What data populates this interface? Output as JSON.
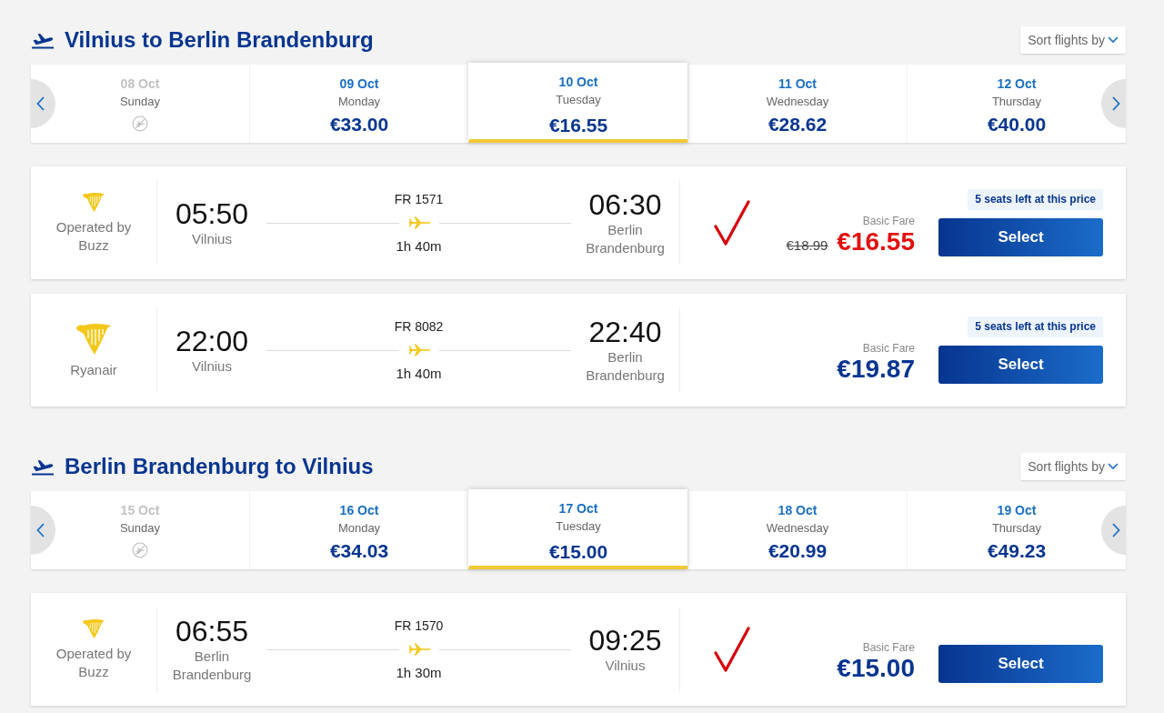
{
  "sections": [
    {
      "title": "Vilnius to Berlin Brandenburg",
      "sort_label": "Sort flights by",
      "dates": [
        {
          "date": "08 Oct",
          "day": "Sunday",
          "available": false,
          "selected": false
        },
        {
          "date": "09 Oct",
          "day": "Monday",
          "available": true,
          "price": "€33.00",
          "selected": false
        },
        {
          "date": "10 Oct",
          "day": "Tuesday",
          "available": true,
          "price": "€16.55",
          "selected": true
        },
        {
          "date": "11 Oct",
          "day": "Wednesday",
          "available": true,
          "price": "€28.62",
          "selected": false
        },
        {
          "date": "12 Oct",
          "day": "Thursday",
          "available": true,
          "price": "€40.00",
          "selected": false
        }
      ],
      "flights": [
        {
          "operator": {
            "kind": "partner",
            "label": "Operated by Buzz"
          },
          "departure": {
            "time": "05:50",
            "city": "Vilnius"
          },
          "flight_number": "FR 1571",
          "duration": "1h 40m",
          "arrival": {
            "time": "06:30",
            "city": "Berlin Brandenburg"
          },
          "checked": true,
          "fare_label": "Basic Fare",
          "old_price": "€18.99",
          "price": "€16.55",
          "sale": true,
          "seats_badge": "5 seats left at this price",
          "button": "Select"
        },
        {
          "operator": {
            "kind": "own",
            "label": "Ryanair"
          },
          "departure": {
            "time": "22:00",
            "city": "Vilnius"
          },
          "flight_number": "FR 8082",
          "duration": "1h 40m",
          "arrival": {
            "time": "22:40",
            "city": "Berlin Brandenburg"
          },
          "checked": false,
          "fare_label": "Basic Fare",
          "price": "€19.87",
          "sale": false,
          "seats_badge": "5 seats left at this price",
          "button": "Select"
        }
      ]
    },
    {
      "title": "Berlin Brandenburg to Vilnius",
      "sort_label": "Sort flights by",
      "dates": [
        {
          "date": "15 Oct",
          "day": "Sunday",
          "available": false,
          "selected": false
        },
        {
          "date": "16 Oct",
          "day": "Monday",
          "available": true,
          "price": "€34.03",
          "selected": false
        },
        {
          "date": "17 Oct",
          "day": "Tuesday",
          "available": true,
          "price": "€15.00",
          "selected": true
        },
        {
          "date": "18 Oct",
          "day": "Wednesday",
          "available": true,
          "price": "€20.99",
          "selected": false
        },
        {
          "date": "19 Oct",
          "day": "Thursday",
          "available": true,
          "price": "€49.23",
          "selected": false
        }
      ],
      "flights": [
        {
          "operator": {
            "kind": "partner",
            "label": "Operated by Buzz"
          },
          "departure": {
            "time": "06:55",
            "city": "Berlin Brandenburg"
          },
          "flight_number": "FR 1570",
          "duration": "1h 30m",
          "arrival": {
            "time": "09:25",
            "city": "Vilnius"
          },
          "checked": true,
          "fare_label": "Basic Fare",
          "price": "€15.00",
          "sale": false,
          "button": "Select"
        }
      ]
    }
  ]
}
